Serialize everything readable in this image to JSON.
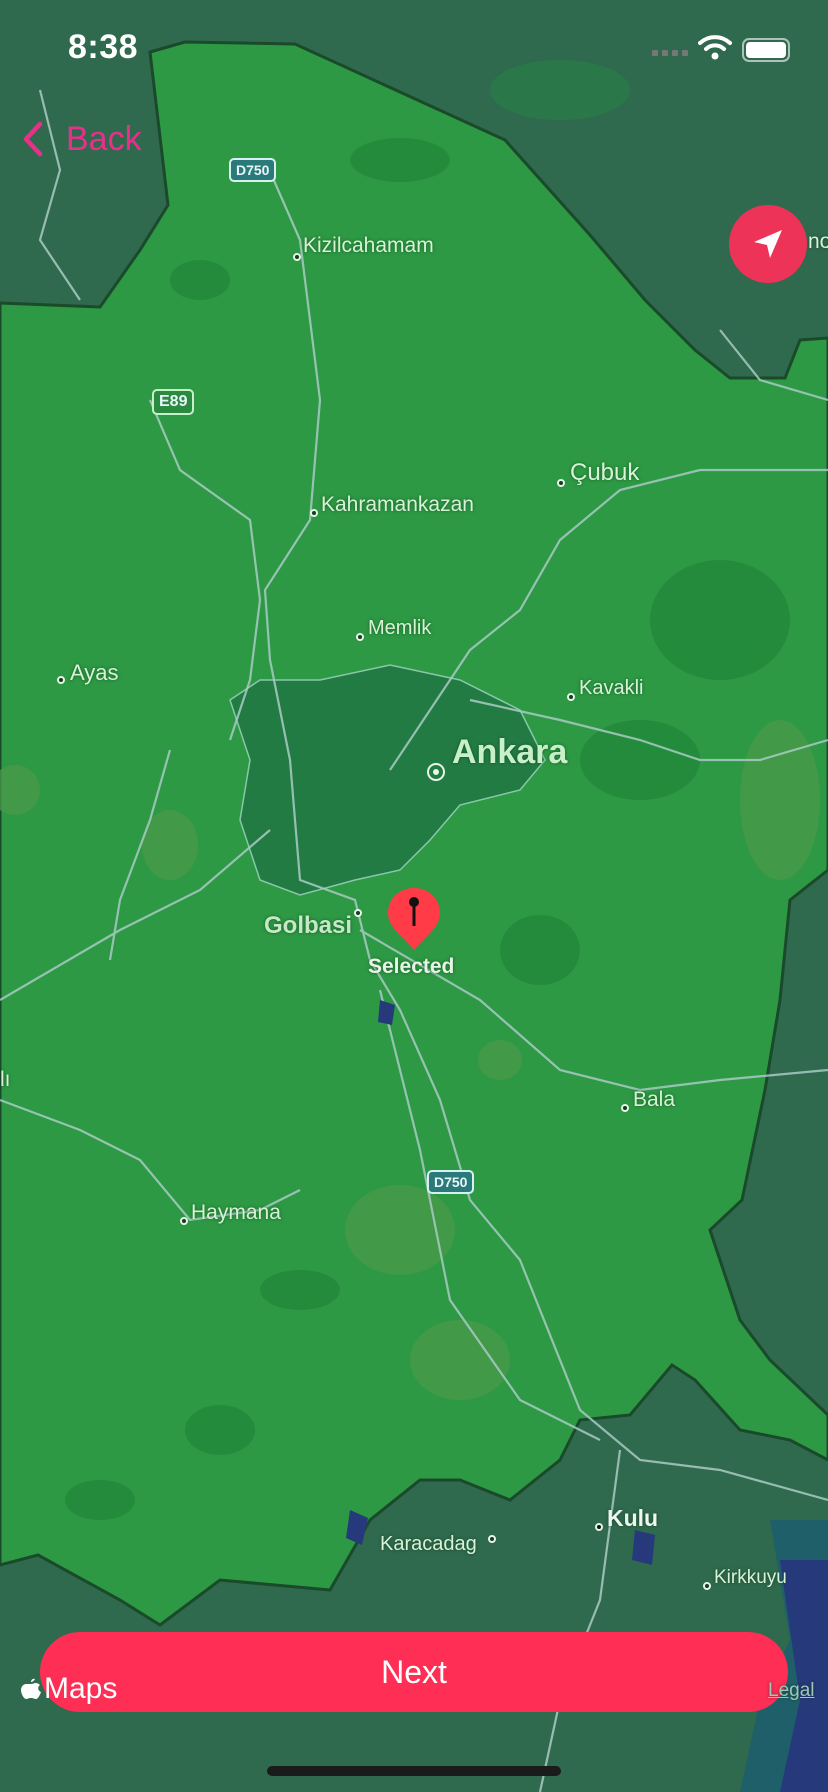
{
  "status_bar": {
    "time": "8:38"
  },
  "nav": {
    "back_label": "Back"
  },
  "map": {
    "places": {
      "kizilcahamam": "Kizilcahamam",
      "cubuk": "Çubuk",
      "kahramankazan": "Kahramankazan",
      "memlik": "Memlik",
      "ayas": "Ayas",
      "kavakli": "Kavakli",
      "ankara": "Ankara",
      "golbasi": "Golbasi",
      "bala": "Bala",
      "haymana": "Haymana",
      "karacadag": "Karacadag",
      "kulu": "Kulu",
      "kirkkuyu": "Kirkkuyu",
      "edge_right": "nox",
      "edge_left": "lı"
    },
    "roads": {
      "d750_north": "D750",
      "e89": "E89",
      "d750_south": "D750"
    },
    "pin_label": "Selected",
    "attribution": "Maps",
    "legal": "Legal",
    "colors": {
      "region": "#2d9944",
      "outside": "#2f6a4e",
      "water": "#26397a",
      "pin": "#ff3b48",
      "accent": "#e8308a"
    }
  },
  "actions": {
    "next_label": "Next"
  }
}
